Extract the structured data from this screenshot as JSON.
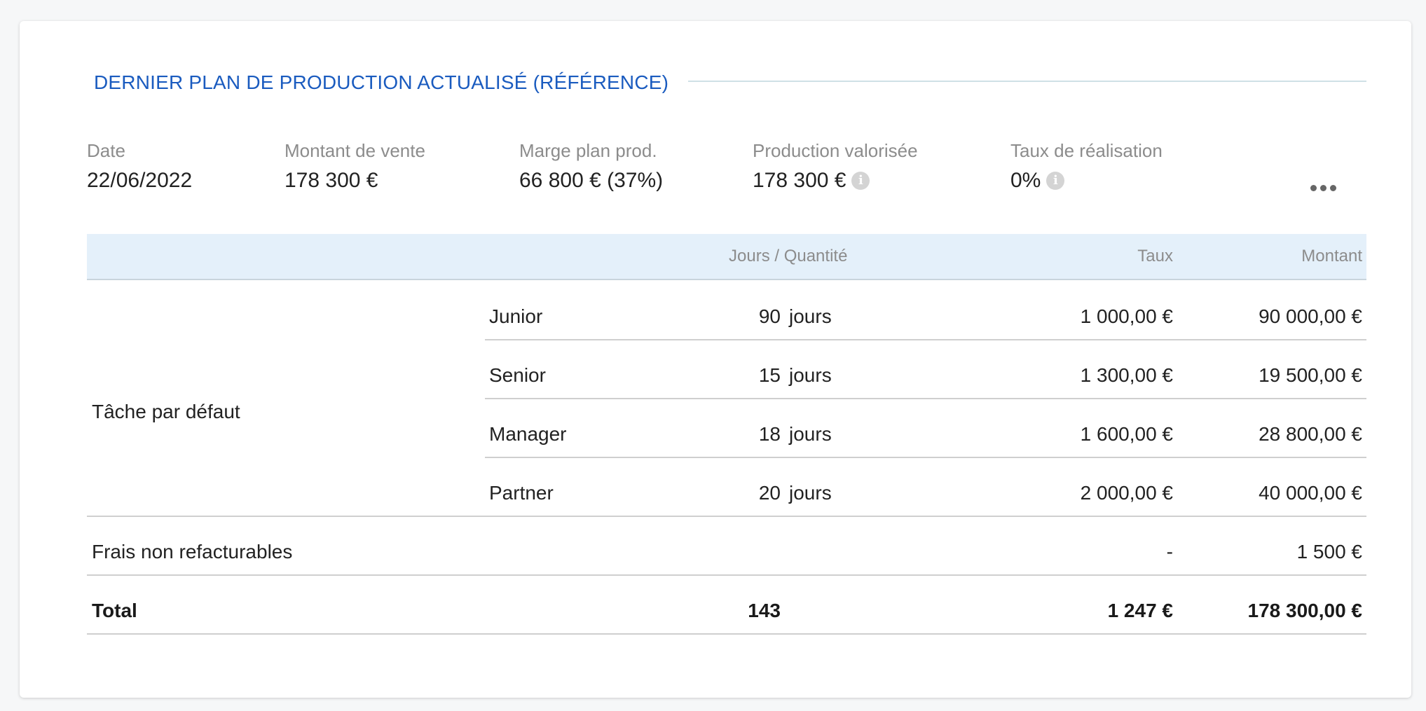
{
  "section": {
    "title": "DERNIER PLAN DE PRODUCTION ACTUALISÉ (RÉFÉRENCE)"
  },
  "summary": {
    "date": {
      "label": "Date",
      "value": "22/06/2022"
    },
    "sale_amount": {
      "label": "Montant de vente",
      "value": "178 300 €"
    },
    "margin": {
      "label": "Marge plan prod.",
      "value": "66 800 € (37%)"
    },
    "production": {
      "label": "Production valorisée",
      "value": "178 300 €",
      "info_icon": "info-icon"
    },
    "rate": {
      "label": "Taux de réalisation",
      "value": "0%",
      "info_icon": "info-icon"
    },
    "more_icon": "more-horizontal-icon"
  },
  "table": {
    "headers": {
      "qty": "Jours / Quantité",
      "rate": "Taux",
      "amount": "Montant"
    },
    "task": {
      "label": "Tâche par défaut"
    },
    "rows": [
      {
        "role": "Junior",
        "qty": "90",
        "unit": "jours",
        "rate": "1 000,00 €",
        "amount": "90 000,00 €"
      },
      {
        "role": "Senior",
        "qty": "15",
        "unit": "jours",
        "rate": "1 300,00 €",
        "amount": "19 500,00 €"
      },
      {
        "role": "Manager",
        "qty": "18",
        "unit": "jours",
        "rate": "1 600,00 €",
        "amount": "28 800,00 €"
      },
      {
        "role": "Partner",
        "qty": "20",
        "unit": "jours",
        "rate": "2 000,00 €",
        "amount": "40 000,00 €"
      }
    ],
    "fees": {
      "label": "Frais non refacturables",
      "rate": "-",
      "amount": "1 500 €"
    },
    "total": {
      "label": "Total",
      "qty": "143",
      "rate": "1 247 €",
      "amount": "178 300,00 €"
    }
  },
  "colors": {
    "title": "#1a5bbf",
    "header_bg": "#e4f0fa",
    "muted_text": "#8c8c8c"
  }
}
